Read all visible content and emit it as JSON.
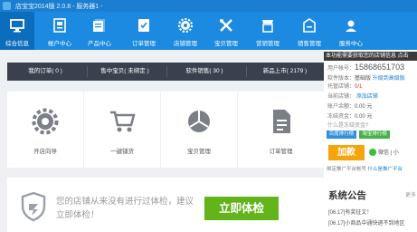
{
  "window": {
    "title": "店宝宝2014版 2.0.8 - 服务器1 -"
  },
  "toolbar": {
    "items": [
      {
        "label": "综合信息",
        "icon": "monitor-icon"
      },
      {
        "label": "帐户中心",
        "icon": "account-icon"
      },
      {
        "label": "产品中心",
        "icon": "product-icon"
      },
      {
        "label": "订单管理",
        "icon": "order-icon"
      },
      {
        "label": "店铺管理",
        "icon": "gear-icon"
      },
      {
        "label": "宝贝管理",
        "icon": "tools-icon"
      },
      {
        "label": "营销管理",
        "icon": "marketing-icon"
      },
      {
        "label": "销售管理",
        "icon": "sales-icon"
      },
      {
        "label": "服务中心",
        "icon": "service-icon"
      }
    ]
  },
  "stats": [
    "我的订单( 0 )",
    "售中宝贝( 未绑定 )",
    "软件销售( 30 )",
    "新品上市( 2179 )"
  ],
  "cards": [
    "开店向导",
    "一键铺货",
    "宝贝管理",
    "订单管理"
  ],
  "health": {
    "message": "您的店铺从来没有进行过体检，建议立即体检！",
    "button": "立即体检"
  },
  "account": {
    "notice": "本功能需要获取您的店铺信息 点击",
    "rows": [
      {
        "label": "用户帐号：",
        "value": "15868651703"
      },
      {
        "label": "软件版本：",
        "value": "基础版",
        "link": "升级到高级版"
      },
      {
        "label": "托管店铺：",
        "value": "0/1"
      },
      {
        "label": "当前店铺：",
        "link": "添加店铺"
      },
      {
        "label": "账户余额：",
        "value": "0.00 元"
      },
      {
        "label": "冻结资金：",
        "value": "0.00 元"
      },
      {
        "label": "什么是冻结资金?"
      }
    ],
    "tags": [
      "百度排行榜",
      "淘宝排行榜"
    ],
    "bonus": "加款",
    "wechat": "微信 | 小",
    "bind": {
      "label": "绑定推广平台帐号",
      "link": "什么是推广平台"
    }
  },
  "announce": {
    "title": "系统公告",
    "more": "更多",
    "items": [
      "[06.17]有奖征文！",
      "[06.17]小商品中通快递不到地区"
    ]
  },
  "colors": {
    "brand": "#1b8ae0",
    "active": "#0d6dbd",
    "stats_bar": "#39414f",
    "go": "#62b41a",
    "bonus": "#f5a40c"
  }
}
